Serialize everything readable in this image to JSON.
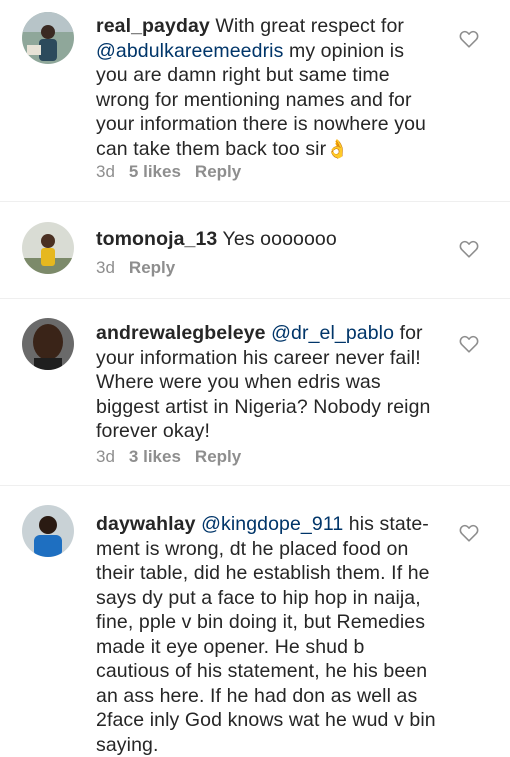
{
  "comments": [
    {
      "username": "real_payday",
      "parts": [
        {
          "t": " With great respect for "
        },
        {
          "t": "@abdulkareemeedris",
          "m": true
        },
        {
          "t": " my opinion is you are damn right but same time wrong for mentioning names and for your information there is nowhere you can take them back too sir"
        }
      ],
      "emoji": "👌",
      "time": "3d",
      "likes": "5 likes",
      "reply": "Reply"
    },
    {
      "username": "tomonoja_13",
      "parts": [
        {
          "t": " Yes ooooooo"
        }
      ],
      "time": "3d",
      "likes": "",
      "reply": "Reply"
    },
    {
      "username": "andrewalegbeleye",
      "parts": [
        {
          "t": " "
        },
        {
          "t": "@dr_el_pablo",
          "m": true
        },
        {
          "t": " for your information his career never fail! Where were you when edris was biggest artist in Nigeria?  Nobody reign forever okay!"
        }
      ],
      "time": "3d",
      "likes": "3 likes",
      "reply": "Reply"
    },
    {
      "username": "daywahlay",
      "parts": [
        {
          "t": " "
        },
        {
          "t": "@kingdope_911",
          "m": true
        },
        {
          "t": " his state-ment is wrong, dt he placed food on their table, did he establish them. If he says dy put a face to hip hop in naija, fine, pple v bin doing it, but Remedies made it eye opener. He shud b cautious of his statement, he his been an ass here. If he had don as well as 2face inly God knows wat he wud v bin saying."
        }
      ]
    }
  ],
  "colors": {
    "mention": "#003569",
    "meta": "#8e8e8e"
  },
  "icons": {
    "like": "heart-outline-icon"
  }
}
